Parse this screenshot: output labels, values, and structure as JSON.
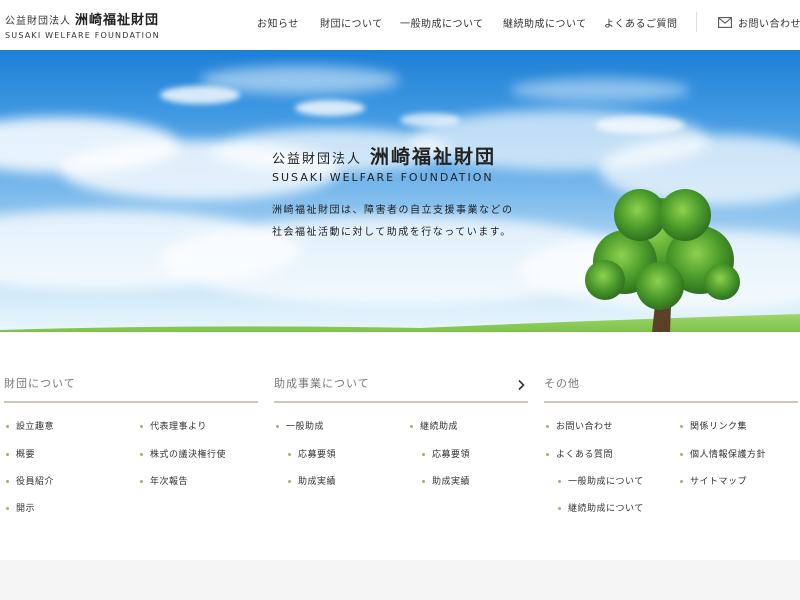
{
  "header": {
    "logo_small": "公益財団法人",
    "logo_big": "洲崎福祉財団",
    "logo_en": "SUSAKI WELFARE FOUNDATION",
    "nav": [
      {
        "label": "お知らせ"
      },
      {
        "label": "財団について"
      },
      {
        "label": "一般助成について"
      },
      {
        "label": "継続助成について"
      },
      {
        "label": "よくあるご質問"
      }
    ],
    "contact_label": "お問い合わせ"
  },
  "hero": {
    "small": "公益財団法人",
    "big": "洲崎福祉財団",
    "en": "SUSAKI WELFARE FOUNDATION",
    "desc_line1": "洲崎福祉財団は、障害者の自立支援事業などの",
    "desc_line2": "社会福祉活動に対して助成を行なっています。"
  },
  "footer_menu": {
    "about": {
      "title": "財団について",
      "links": [
        "設立趣意",
        "代表理事より",
        "概要",
        "株式の議決権行使",
        "役員紹介",
        "年次報告",
        "開示"
      ]
    },
    "grants": {
      "title": "助成事業について",
      "links": [
        "一般助成",
        "継続助成",
        "応募要領",
        "応募要領",
        "助成実績",
        "助成実績"
      ]
    },
    "other": {
      "title": "その他",
      "links": [
        "お問い合わせ",
        "関係リンク集",
        "よくある質問",
        "個人情報保護方針",
        "一般助成について",
        "サイトマップ",
        "継続助成について"
      ]
    }
  },
  "colors": {
    "accent_rule": "#cdc7b6",
    "bullet": "#b5a878",
    "sky_top": "#1d7fd6"
  }
}
